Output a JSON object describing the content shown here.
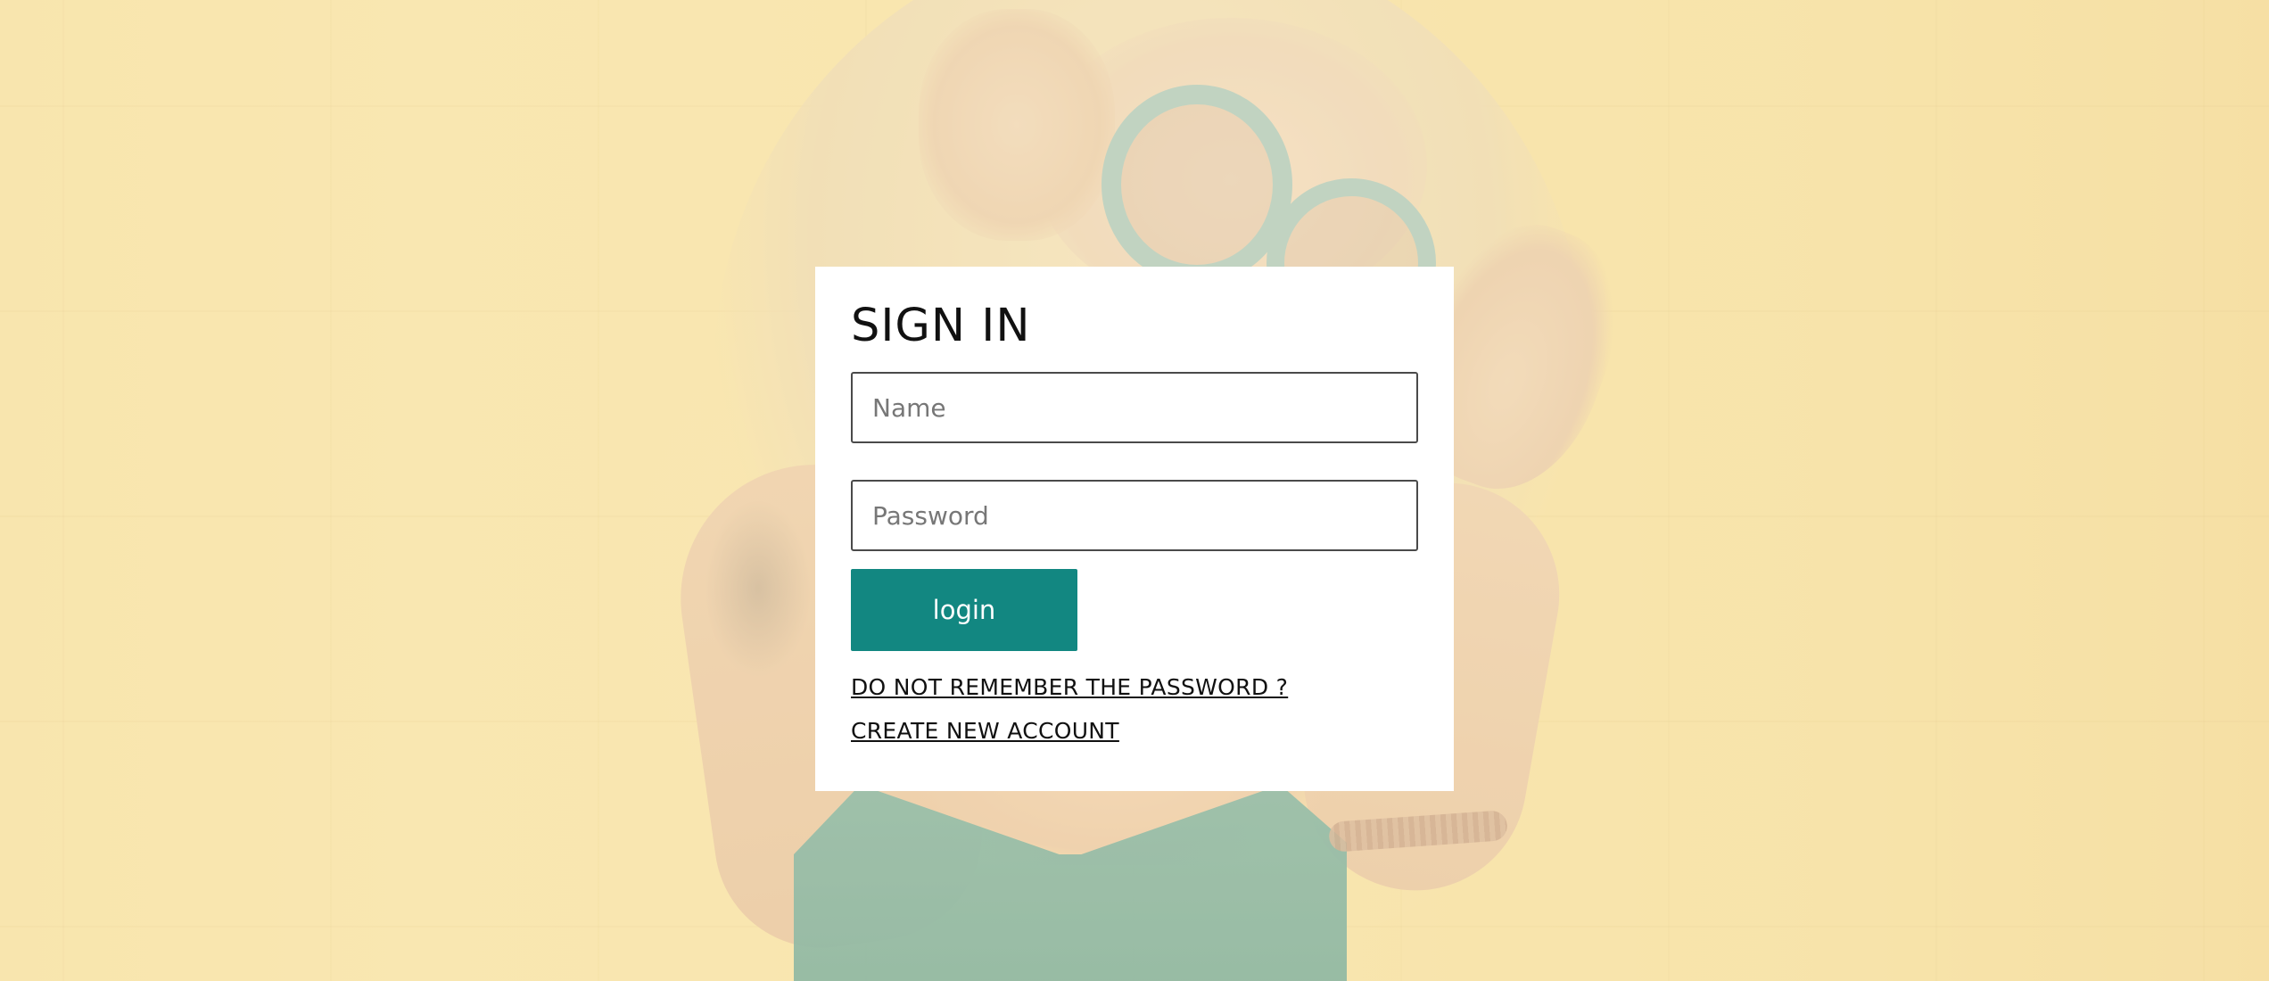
{
  "signin": {
    "title": "SIGN IN",
    "name_placeholder": "Name",
    "password_placeholder": "Password",
    "login_label": "login",
    "forgot_link": "DO NOT REMEMBER THE PASSWORD ?",
    "create_link": "CREATE NEW ACCOUNT"
  },
  "colors": {
    "accent": "#128781",
    "card": "#ffffff",
    "background": "#f5e0a0"
  }
}
